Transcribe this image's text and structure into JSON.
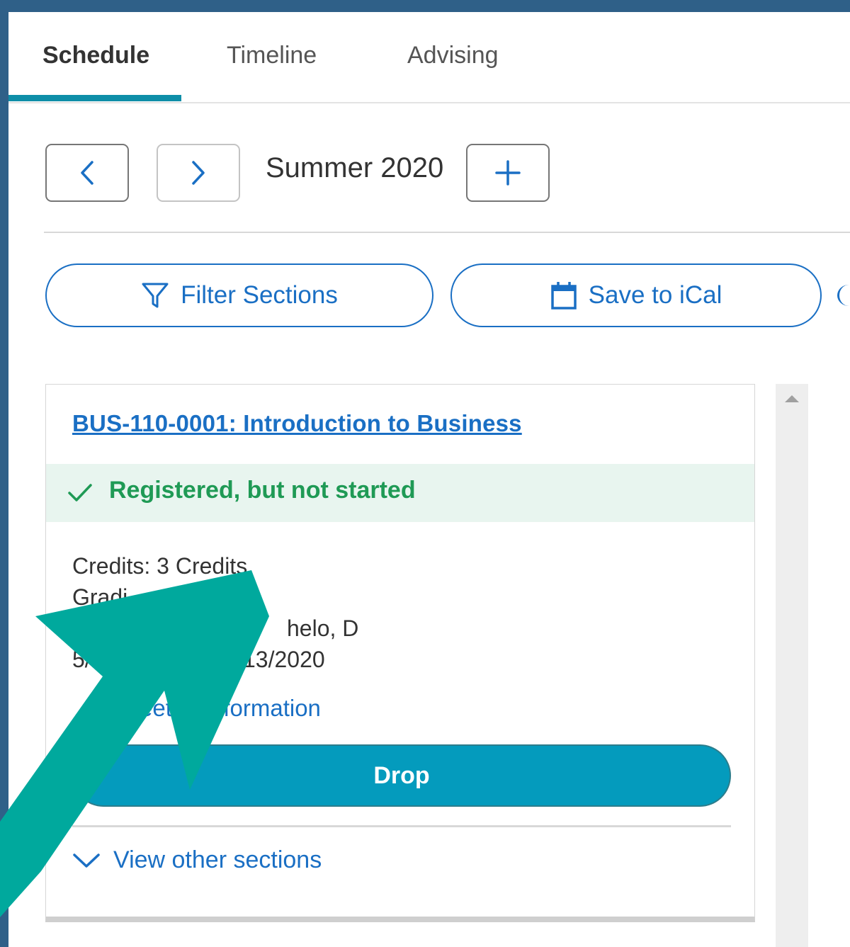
{
  "tabs": [
    {
      "label": "Schedule",
      "active": true
    },
    {
      "label": "Timeline",
      "active": false
    },
    {
      "label": "Advising",
      "active": false
    }
  ],
  "term_nav": {
    "term": "Summer 2020",
    "prev_icon": "chevron-left-icon",
    "next_icon": "chevron-right-icon",
    "add_icon": "plus-icon"
  },
  "actions": {
    "filter_label": "Filter Sections",
    "filter_icon": "filter-icon",
    "ical_label": "Save to iCal",
    "ical_icon": "calendar-icon"
  },
  "course": {
    "title": "BUS-110-0001: Introduction to Business",
    "status": "Registered, but not started",
    "credits": "Credits: 3 Credits",
    "grading": "Gradi",
    "instructor": "helo, D",
    "dates_start": "5/1",
    "dates_end": "13/2020",
    "meeting_link_left": "eet",
    "meeting_link_right": "nformation",
    "drop_label": "Drop",
    "view_other_label": "View other sections"
  },
  "colors": {
    "background": "#2f6088",
    "accent_blue": "#1a6fc4",
    "tab_indicator": "#0e8ea8",
    "status_green": "#1f9a55",
    "status_bg": "#e8f5ef",
    "drop_button": "#049bbd",
    "arrow": "#00a99d"
  }
}
